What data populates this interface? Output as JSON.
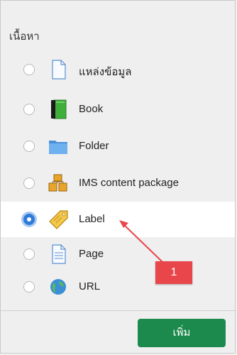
{
  "section": {
    "title": "เนื้อหา"
  },
  "options": [
    {
      "label": "แหล่งข้อมูล",
      "icon": "file-icon",
      "selected": false
    },
    {
      "label": "Book",
      "icon": "book-icon",
      "selected": false
    },
    {
      "label": "Folder",
      "icon": "folder-icon",
      "selected": false
    },
    {
      "label": "IMS content package",
      "icon": "package-icon",
      "selected": false
    },
    {
      "label": "Label",
      "icon": "tag-icon",
      "selected": true
    },
    {
      "label": "Page",
      "icon": "page-icon",
      "selected": false
    },
    {
      "label": "URL",
      "icon": "globe-icon",
      "selected": false
    }
  ],
  "footer": {
    "add_label": "เพิ่ม"
  },
  "annotation": {
    "badge_text": "1",
    "color": "#e8464a"
  },
  "colors": {
    "accent_button": "#1b8a4c",
    "radio_selected": "#2f7bd8"
  }
}
